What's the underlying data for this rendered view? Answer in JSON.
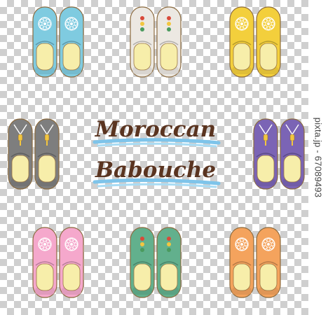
{
  "title": {
    "line1": "Moroccan",
    "line2": "Babouche"
  },
  "watermark": "pixta.jp - 67089493",
  "slippers": [
    {
      "name": "babouche-sky-blue",
      "color": "#7fcbe0",
      "pattern": "flower"
    },
    {
      "name": "babouche-white",
      "color": "#ece8e2",
      "pattern": "dots"
    },
    {
      "name": "babouche-yellow",
      "color": "#f3cf3c",
      "pattern": "flower"
    },
    {
      "name": "babouche-gray",
      "color": "#7e7e7e",
      "pattern": "tassel"
    },
    {
      "name": "babouche-purple",
      "color": "#7b64b5",
      "pattern": "tassel"
    },
    {
      "name": "babouche-pink",
      "color": "#f5a8cc",
      "pattern": "flower"
    },
    {
      "name": "babouche-green",
      "color": "#62b08d",
      "pattern": "dots"
    },
    {
      "name": "babouche-orange",
      "color": "#f4a35d",
      "pattern": "flower"
    }
  ],
  "colors": {
    "insole": "#f7eeaa",
    "outline": "#8b6a3e",
    "title_brown": "#5a3420",
    "swash_blue": "#7ec4ea"
  }
}
